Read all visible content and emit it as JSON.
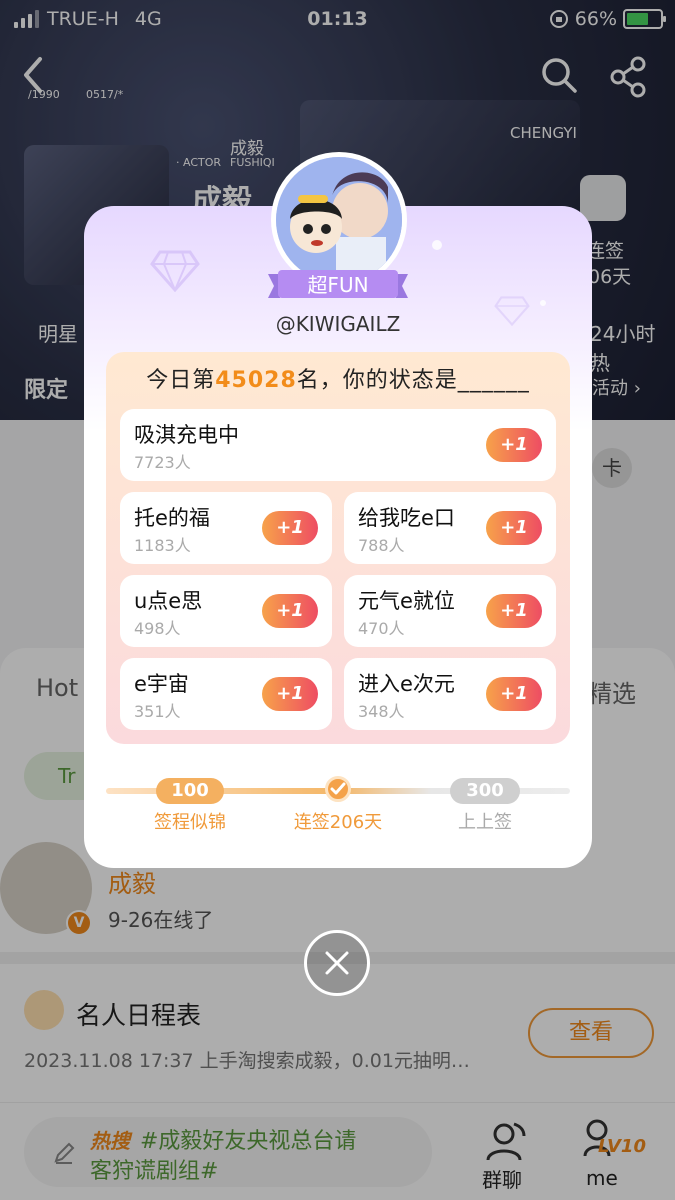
{
  "status_bar": {
    "carrier": "TRUE-H",
    "network": "4G",
    "time": "01:13",
    "battery_percent": "66%",
    "battery_level": 0.66
  },
  "header": {
    "date_left": "/1990",
    "date_right": "0517/*",
    "name_small": "成毅",
    "actor_label": "· ACTOR",
    "actor_name": "FUSHIQI",
    "chengyi_tag": "CHENGYI",
    "big_name": "成毅",
    "sign_label": "连签",
    "sign_days": "06天"
  },
  "background": {
    "star_label": "明星",
    "limited_label": "限定",
    "hot24": "24小时热",
    "activity": "活动 ›",
    "card_btn": "卡",
    "hot_tab": "Hot",
    "featured_tab": "精选",
    "trend_pill": "Tr",
    "post_name": "成毅",
    "post_status": "9-26在线了",
    "schedule_title": "名人日程表",
    "schedule_item": "2023.11.08 17:37 上手淘搜索成毅，0.01元抽明…",
    "view_button": "查看",
    "hot_prefix": "热搜",
    "hot_topic_line1": "#成毅好友央视总台请",
    "hot_topic_line2": "客狩谎剧组#",
    "group_chat": "群聊",
    "me": "me",
    "level": "LV10"
  },
  "modal": {
    "level_badge": "超FUN",
    "username": "@KIWIGAILZ",
    "headline_prefix": "今日第",
    "rank": "45028",
    "headline_suffix": "名，你的状态是______",
    "plus_label": "+1",
    "options": [
      {
        "label": "吸淇充电中",
        "count": "7723人"
      },
      {
        "label": "托e的福",
        "count": "1183人"
      },
      {
        "label": "给我吃e口",
        "count": "788人"
      },
      {
        "label": "u点e思",
        "count": "498人"
      },
      {
        "label": "元气e就位",
        "count": "470人"
      },
      {
        "label": "e宇宙",
        "count": "351人"
      },
      {
        "label": "进入e次元",
        "count": "348人"
      }
    ],
    "milestones": [
      {
        "badge": "100天",
        "label": "签程似锦"
      },
      {
        "badge": "",
        "label": "连签206天"
      },
      {
        "badge": "300天",
        "label": "上上签"
      }
    ]
  },
  "colors": {
    "accent_orange": "#f28c1a",
    "plus_gradient_start": "#f7a24a",
    "plus_gradient_end": "#ee4d63",
    "level_purple": "#b58cf2"
  }
}
